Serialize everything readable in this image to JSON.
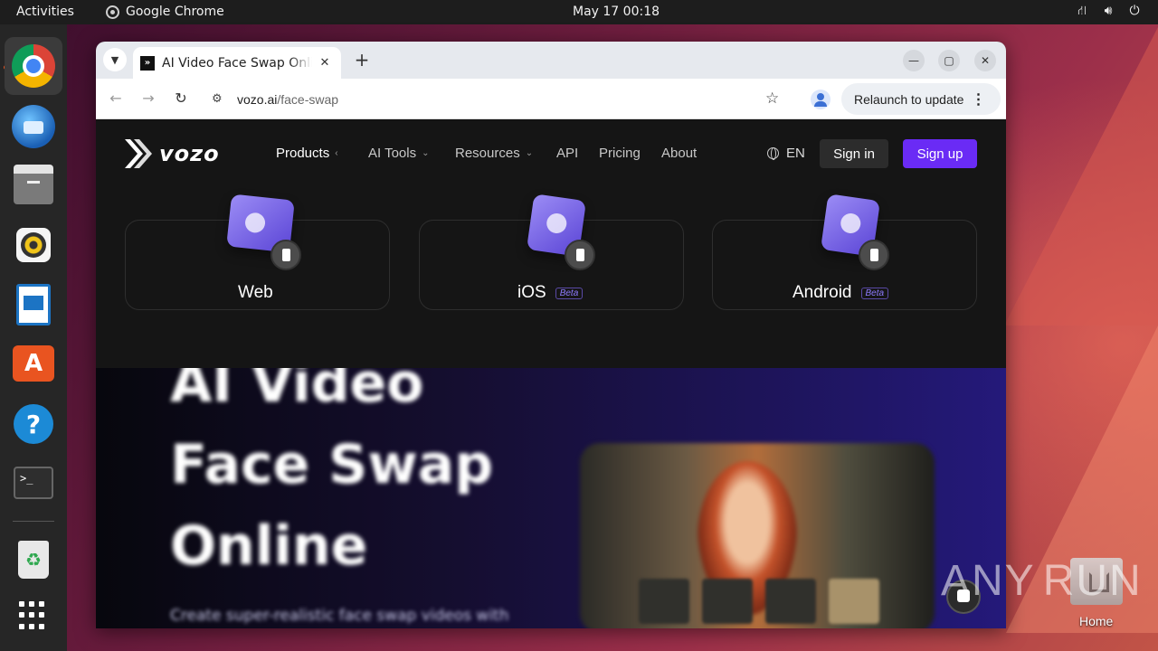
{
  "topbar": {
    "activities": "Activities",
    "app_name": "Google Chrome",
    "clock": "May 17  00:18"
  },
  "dock": {
    "items": [
      "chrome-icon",
      "thunderbird-icon",
      "files-icon",
      "rhythmbox-icon",
      "libreoffice-writer-icon",
      "app-center-icon",
      "help-icon",
      "terminal-icon",
      "trash-icon",
      "show-apps-icon"
    ]
  },
  "desktop": {
    "home_label": "Home",
    "watermark_left": "ANY",
    "watermark_right": "RUN"
  },
  "browser": {
    "tab_title": "AI Video Face Swap Online",
    "url_host": "vozo.ai",
    "url_path": "/face-swap",
    "relaunch_label": "Relaunch to update"
  },
  "site": {
    "brand": "vozo",
    "nav": [
      "Products",
      "AI Tools",
      "Resources",
      "API",
      "Pricing",
      "About"
    ],
    "lang": "EN",
    "signin": "Sign in",
    "signup": "Sign up",
    "platforms": [
      {
        "label": "Web",
        "badge": ""
      },
      {
        "label": "iOS",
        "badge": "Beta"
      },
      {
        "label": "Android",
        "badge": "Beta"
      }
    ],
    "hero_lines": [
      "AI Video",
      "Face Swap",
      "Online"
    ],
    "hero_sub": "Create super-realistic face swap videos with",
    "accent": "#6a2bf5"
  }
}
